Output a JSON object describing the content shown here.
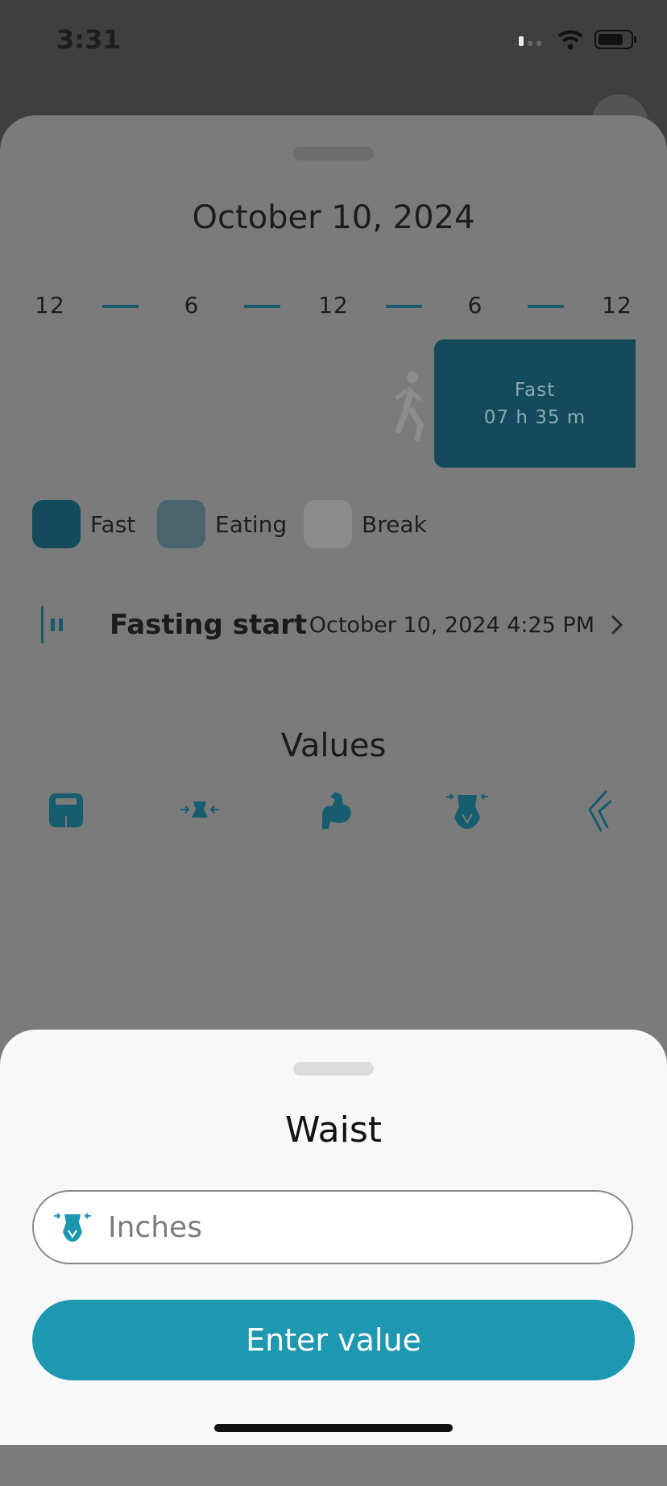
{
  "status_bar": {
    "time": "3:31"
  },
  "sheet": {
    "date": "October 10, 2024",
    "scale": [
      "12",
      "6",
      "12",
      "6",
      "12"
    ],
    "fast_block": {
      "label": "Fast",
      "duration": "07 h 35 m"
    },
    "legend": [
      {
        "label": "Fast",
        "color": "#134b5c"
      },
      {
        "label": "Eating",
        "color": "#4b6570"
      },
      {
        "label": "Break",
        "color": "#8a8a8a"
      }
    ],
    "fasting_start": {
      "label": "Fasting start",
      "value": "October 10, 2024 4:25 PM"
    },
    "values_title": "Values",
    "value_icons": [
      "scale-icon",
      "waist-icon",
      "biceps-icon",
      "hips-icon",
      "knee-icon"
    ]
  },
  "modal": {
    "title": "Waist",
    "input_placeholder": "Inches",
    "button_label": "Enter value"
  },
  "colors": {
    "accent": "#1e97b1",
    "dark_teal": "#134b5c"
  }
}
